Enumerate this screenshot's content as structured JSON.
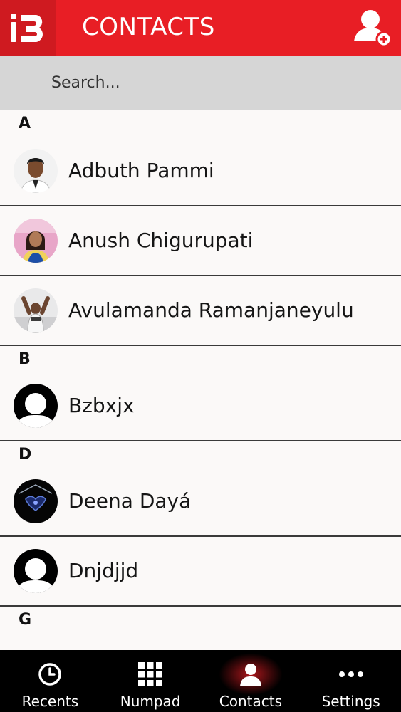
{
  "header": {
    "title": "CONTACTS",
    "logo_icon": "ib-logo-icon",
    "add_icon": "add-contact-icon",
    "bg_color": "#e81e25"
  },
  "search": {
    "placeholder": "Search...",
    "value": "",
    "icon": "search-icon"
  },
  "sections": [
    {
      "letter": "A",
      "contacts": [
        {
          "name": "Adbuth Pammi",
          "avatar": "photo"
        },
        {
          "name": "Anush Chigurupati",
          "avatar": "photo"
        },
        {
          "name": "Avulamanda Ramanjaneyulu",
          "avatar": "photo"
        }
      ]
    },
    {
      "letter": "B",
      "contacts": [
        {
          "name": "Bzbxjx",
          "avatar": "default-silhouette"
        }
      ]
    },
    {
      "letter": "D",
      "contacts": [
        {
          "name": "Deena Dayá",
          "avatar": "photo-dark"
        },
        {
          "name": "Dnjdjjd",
          "avatar": "default-silhouette"
        }
      ]
    },
    {
      "letter": "G",
      "contacts": []
    }
  ],
  "bottom_nav": {
    "items": [
      {
        "label": "Recents",
        "icon": "clock-icon"
      },
      {
        "label": "Numpad",
        "icon": "grid-icon"
      },
      {
        "label": "Contacts",
        "icon": "person-icon",
        "active": true
      },
      {
        "label": "Settings",
        "icon": "more-dots-icon"
      }
    ],
    "active_color": "#e81e25"
  }
}
